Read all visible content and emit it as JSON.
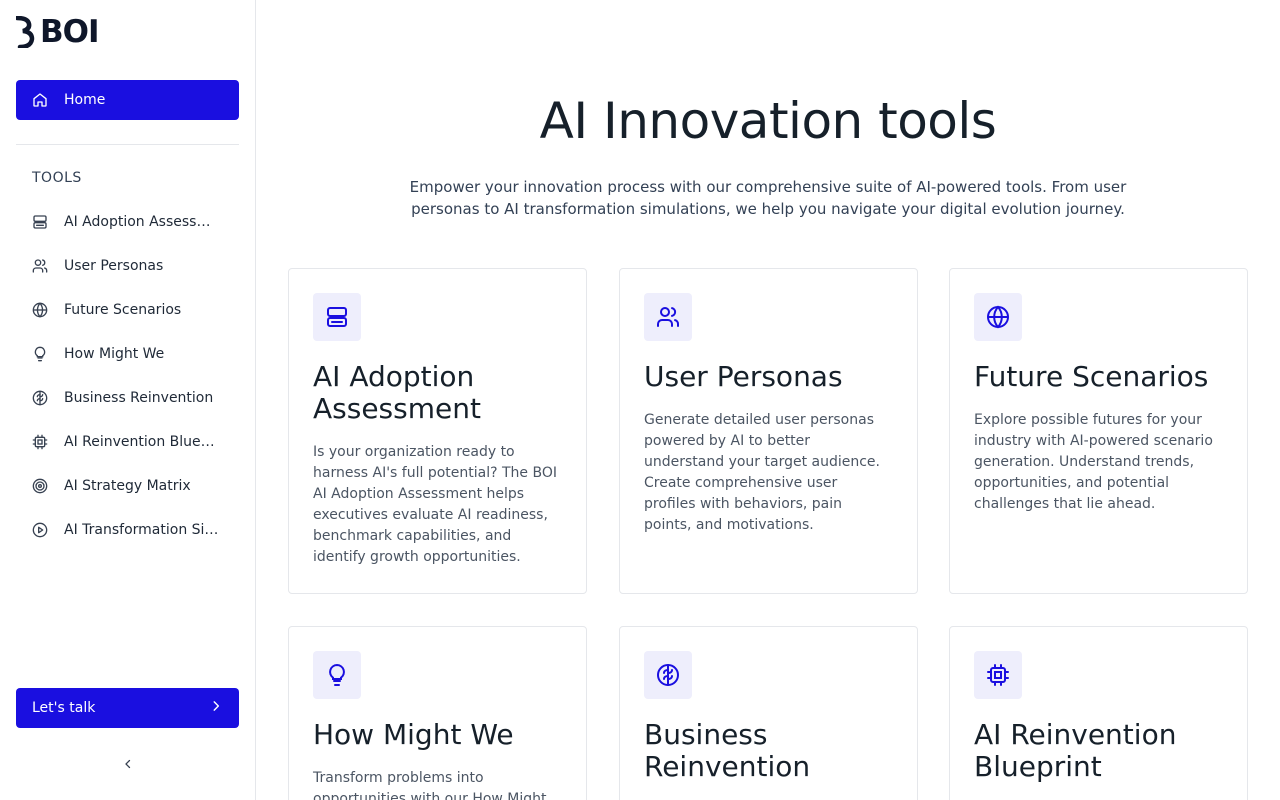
{
  "brand": {
    "logo_text": "BOI"
  },
  "sidebar": {
    "home": {
      "label": "Home",
      "icon": "home-icon"
    },
    "tools_heading": "TOOLS",
    "tools": [
      {
        "label": "AI Adoption Assessment",
        "icon": "server-icon"
      },
      {
        "label": "User Personas",
        "icon": "users-icon"
      },
      {
        "label": "Future Scenarios",
        "icon": "globe-icon"
      },
      {
        "label": "How Might We",
        "icon": "lightbulb-icon"
      },
      {
        "label": "Business Reinvention",
        "icon": "brain-icon"
      },
      {
        "label": "AI Reinvention Blueprint",
        "icon": "cpu-icon"
      },
      {
        "label": "AI Strategy Matrix",
        "icon": "target-icon"
      },
      {
        "label": "AI Transformation Simulation",
        "icon": "play-circle-icon"
      }
    ],
    "cta": {
      "label": "Let's talk",
      "icon": "chevron-right-icon"
    },
    "collapse_icon": "chevron-left-icon"
  },
  "main": {
    "title": "AI Innovation tools",
    "subtitle": "Empower your innovation process with our comprehensive suite of AI-powered tools. From user personas to AI transformation simulations, we help you navigate your digital evolution journey.",
    "cards": [
      {
        "title": "AI Adoption Assessment",
        "icon": "server-icon",
        "description": "Is your organization ready to harness AI's full potential? The BOI AI Adoption Assessment helps executives evaluate AI readiness, benchmark capabilities, and identify growth opportunities."
      },
      {
        "title": "User Personas",
        "icon": "users-icon",
        "description": "Generate detailed user personas powered by AI to better understand your target audience. Create comprehensive user profiles with behaviors, pain points, and motivations."
      },
      {
        "title": "Future Scenarios",
        "icon": "globe-icon",
        "description": "Explore possible futures for your industry with AI-powered scenario generation. Understand trends, opportunities, and potential challenges that lie ahead."
      },
      {
        "title": "How Might We",
        "icon": "lightbulb-icon",
        "description": "Transform problems into opportunities with our How Might We"
      },
      {
        "title": "Business Reinvention",
        "icon": "brain-icon",
        "description": ""
      },
      {
        "title": "AI Reinvention Blueprint",
        "icon": "cpu-icon",
        "description": ""
      }
    ]
  },
  "colors": {
    "accent": "#1a0fe0",
    "icon_bg": "#eeeefc",
    "border": "#e5e7eb",
    "text": "#16202a"
  }
}
